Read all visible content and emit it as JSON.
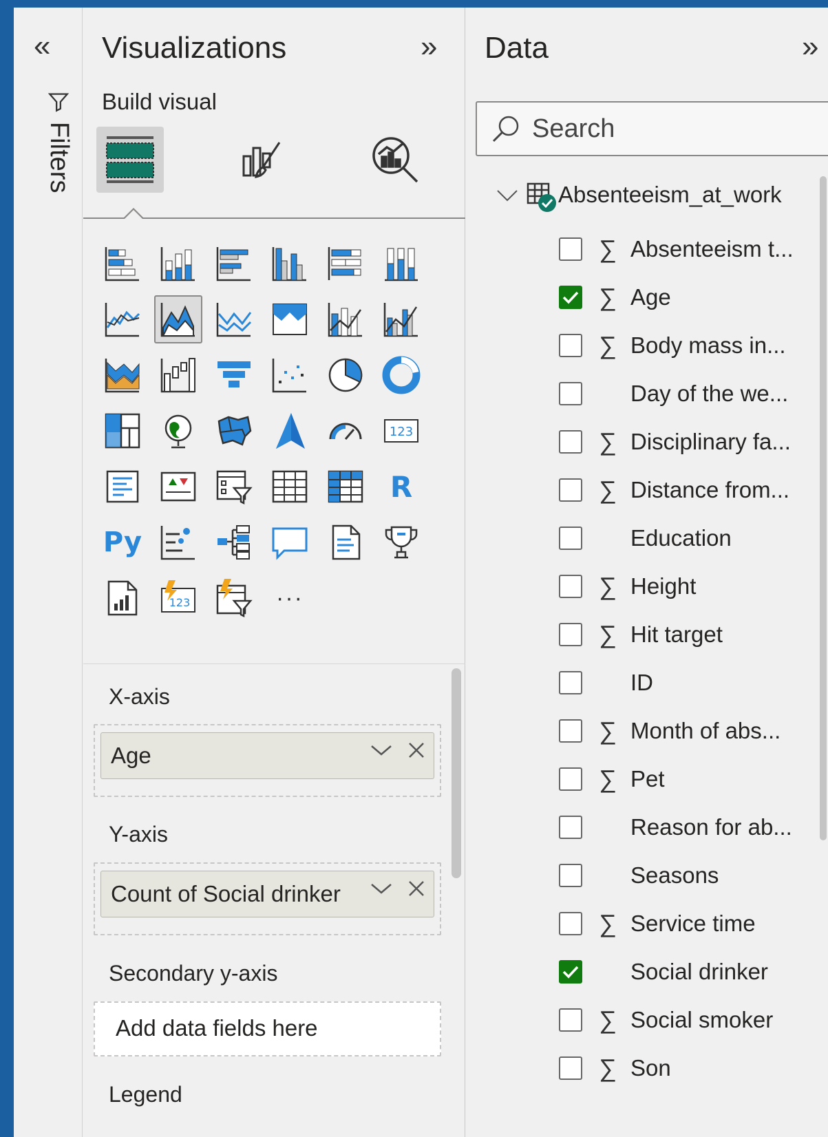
{
  "filters": {
    "label": "Filters",
    "collapse_glyph": "«",
    "icon": "filter-icon"
  },
  "visualizations": {
    "title": "Visualizations",
    "expand_glyph": "»",
    "build_label": "Build visual",
    "tabs": [
      {
        "name": "build-visual-tab",
        "icon": "fields-icon",
        "active": true
      },
      {
        "name": "format-visual-tab",
        "icon": "paintbrush-chart-icon",
        "active": false
      },
      {
        "name": "analytics-tab",
        "icon": "magnifier-chart-icon",
        "active": false
      }
    ],
    "gallery": [
      "stacked-bar-chart",
      "stacked-column-chart",
      "clustered-bar-chart",
      "clustered-column-chart",
      "100-stacked-bar-chart",
      "100-stacked-column-chart",
      "line-chart",
      "area-chart",
      "stacked-area-chart",
      "100-stacked-area-chart",
      "line-and-stacked-column-chart",
      "line-and-clustered-column-chart",
      "ribbon-chart",
      "waterfall-chart",
      "funnel",
      "scatter-chart",
      "pie-chart",
      "donut-chart",
      "treemap",
      "map",
      "filled-map",
      "azure-map",
      "gauge",
      "card",
      "multi-row-card",
      "kpi",
      "slicer",
      "table",
      "matrix",
      "r-script-visual",
      "python-visual",
      "key-influencers",
      "decomposition-tree",
      "qa",
      "smart-narrative",
      "metrics",
      "paginated-report",
      "power-apps-card",
      "power-automate-slicer",
      "more-visuals"
    ],
    "r_text": "R",
    "py_text": "Py",
    "card_text": "123",
    "more_text": "···",
    "wells": {
      "x_axis": {
        "label": "X-axis",
        "field": "Age"
      },
      "y_axis": {
        "label": "Y-axis",
        "field": "Count of Social drinker"
      },
      "secondary_y": {
        "label": "Secondary y-axis",
        "placeholder": "Add data fields here"
      },
      "legend": {
        "label": "Legend"
      }
    }
  },
  "data": {
    "title": "Data",
    "expand_glyph": "»",
    "search_placeholder": "Search",
    "table_name": "Absenteeism_at_work",
    "fields": [
      {
        "name": "Absenteeism t...",
        "sigma": true,
        "checked": false
      },
      {
        "name": "Age",
        "sigma": true,
        "checked": true
      },
      {
        "name": "Body mass in...",
        "sigma": true,
        "checked": false
      },
      {
        "name": "Day of the we...",
        "sigma": false,
        "checked": false
      },
      {
        "name": "Disciplinary fa...",
        "sigma": true,
        "checked": false
      },
      {
        "name": "Distance from...",
        "sigma": true,
        "checked": false
      },
      {
        "name": "Education",
        "sigma": false,
        "checked": false
      },
      {
        "name": "Height",
        "sigma": true,
        "checked": false
      },
      {
        "name": "Hit target",
        "sigma": true,
        "checked": false
      },
      {
        "name": "ID",
        "sigma": false,
        "checked": false
      },
      {
        "name": "Month of abs...",
        "sigma": true,
        "checked": false
      },
      {
        "name": "Pet",
        "sigma": true,
        "checked": false
      },
      {
        "name": "Reason for ab...",
        "sigma": false,
        "checked": false
      },
      {
        "name": "Seasons",
        "sigma": false,
        "checked": false
      },
      {
        "name": "Service time",
        "sigma": true,
        "checked": false
      },
      {
        "name": "Social drinker",
        "sigma": false,
        "checked": true
      },
      {
        "name": "Social smoker",
        "sigma": true,
        "checked": false
      },
      {
        "name": "Son",
        "sigma": true,
        "checked": false
      }
    ],
    "sigma_glyph": "∑"
  },
  "colors": {
    "frame": "#1b5fa0",
    "accent_blue": "#2b88d8",
    "check_green": "#107c10",
    "viz_green": "#117865"
  }
}
